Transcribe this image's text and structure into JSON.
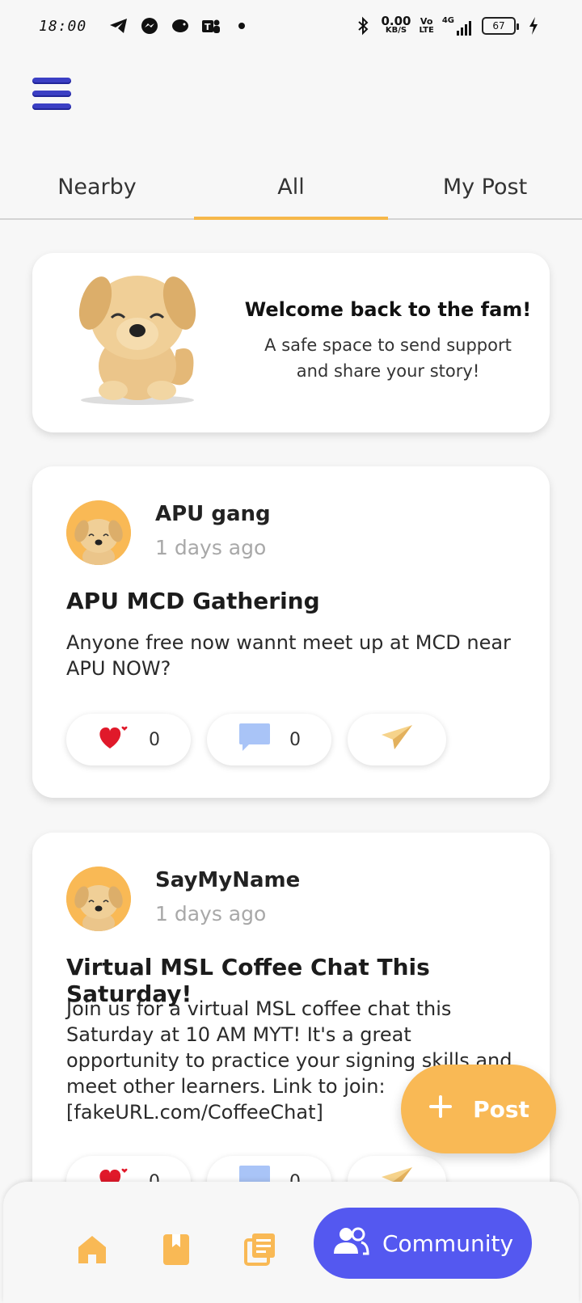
{
  "status_bar": {
    "time": "18:00",
    "net_speed_value": "0.00",
    "net_speed_unit": "KB/S",
    "volte_top": "Vo",
    "volte_bottom": "LTE",
    "network": "4G",
    "battery": "67"
  },
  "tabs": [
    {
      "label": "Nearby"
    },
    {
      "label": "All"
    },
    {
      "label": "My Post"
    }
  ],
  "active_tab": "All",
  "welcome": {
    "title": "Welcome back to the fam!",
    "subtitle_line1": "A safe space to send support",
    "subtitle_line2": "and share your story!"
  },
  "posts": [
    {
      "author": "APU gang",
      "time": "1 days ago",
      "title": "APU MCD Gathering",
      "body": "Anyone free now wannt meet up at MCD near APU NOW?",
      "likes": "0",
      "comments": "0"
    },
    {
      "author": "SayMyName",
      "time": "1 days ago",
      "title": "Virtual MSL Coffee Chat This Saturday!",
      "body": "Join us for a virtual MSL coffee chat this Saturday at 10 AM MYT! It's a great opportunity to practice your signing skills and meet other learners. Link to join: [fakeURL.com/CoffeeChat]",
      "likes": "0",
      "comments": "0"
    }
  ],
  "fab": {
    "label": "Post"
  },
  "bottom_nav": {
    "community_label": "Community"
  },
  "colors": {
    "accent": "#f9b955",
    "primary": "#5458f0",
    "menu": "#3b3fc4"
  }
}
